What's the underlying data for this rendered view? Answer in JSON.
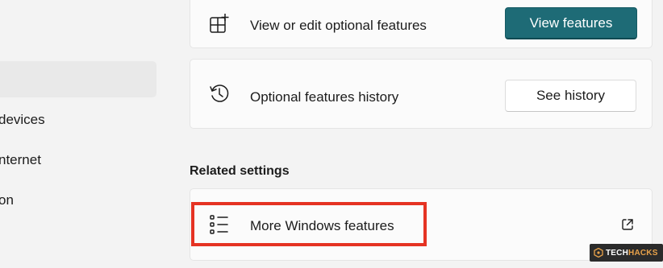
{
  "sidebar": {
    "items": [
      {
        "label": ""
      },
      {
        "label": "devices"
      },
      {
        "label": "nternet"
      },
      {
        "label": "on"
      }
    ]
  },
  "optional_features": {
    "view_label": "View or edit optional features",
    "view_button": "View features",
    "history_label": "Optional features history",
    "history_button": "See history"
  },
  "related_settings": {
    "heading": "Related settings",
    "more_windows_features": "More Windows features"
  },
  "watermark": {
    "prefix": "TECH",
    "suffix": "HACKS"
  },
  "colors": {
    "accent": "#1e6b76",
    "highlight": "#e53323",
    "background": "#f3f3f3",
    "card": "#fbfbfb"
  },
  "icons": {
    "view_features": "add-grid-icon",
    "history": "history-clock-icon",
    "more_windows_features": "list-icon",
    "external_link": "open-external-icon"
  }
}
